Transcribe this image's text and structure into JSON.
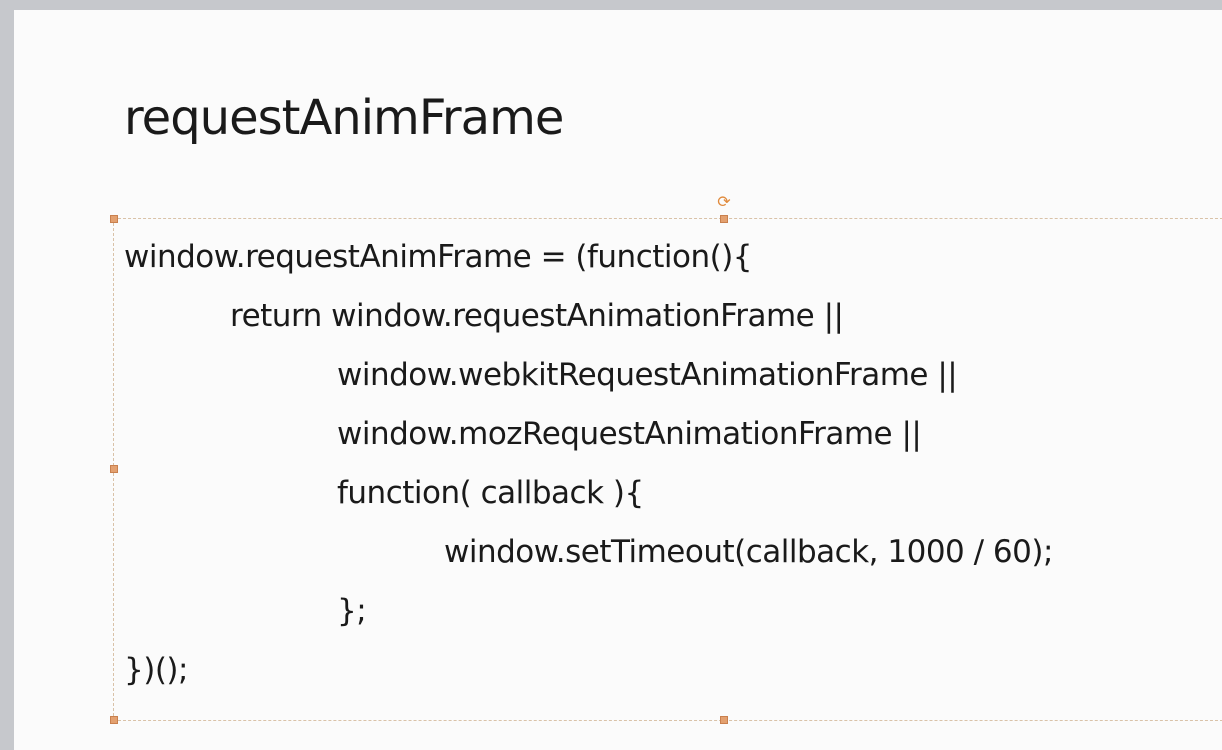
{
  "slide": {
    "title": "requestAnimFrame",
    "code_lines": [
      {
        "text": "window.requestAnimFrame = (function(){",
        "indent": 0
      },
      {
        "text": "return window.requestAnimationFrame ||",
        "indent": 1
      },
      {
        "text": "window.webkitRequestAnimationFrame ||",
        "indent": 2
      },
      {
        "text": "window.mozRequestAnimationFrame ||",
        "indent": 2
      },
      {
        "text": "function( callback ){",
        "indent": 2
      },
      {
        "text": "window.setTimeout(callback, 1000 / 60);",
        "indent": 3
      },
      {
        "text": "};",
        "indent": 2
      },
      {
        "text": "})();",
        "indent": 0
      }
    ]
  },
  "icons": {
    "rotate_handle": "rotate-icon"
  },
  "colors": {
    "handle": "#e3a06f",
    "rotate_handle": "#e08a3c",
    "selection_border": "#d9c2a8",
    "slide_background": "#fbfbfb",
    "text": "#1a1a1a"
  }
}
